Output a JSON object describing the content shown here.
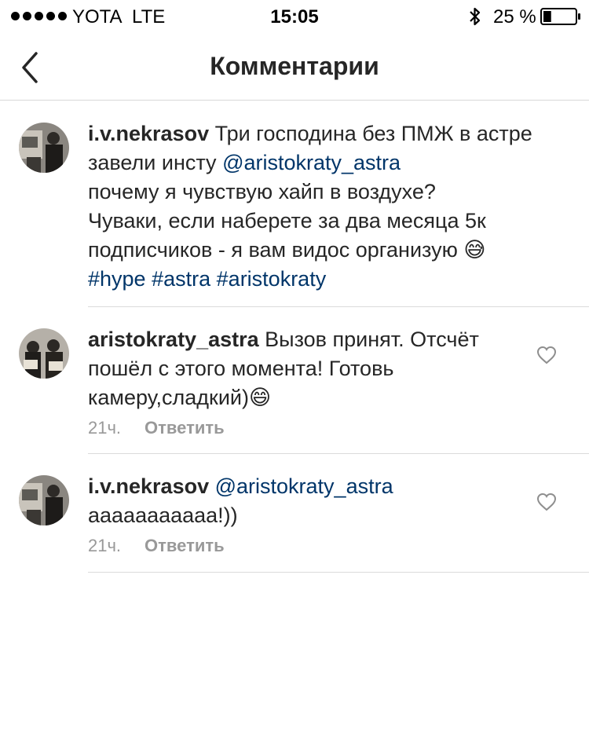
{
  "status_bar": {
    "carrier": "YOTA",
    "network": "LTE",
    "time": "15:05",
    "battery_percent": "25 %",
    "battery_level": 0.25,
    "icons": [
      "signal-dots-icon",
      "bluetooth-icon",
      "battery-icon"
    ]
  },
  "nav": {
    "title": "Комментарии",
    "back_icon": "chevron-left-icon"
  },
  "comments": [
    {
      "username": "i.v.nekrasov",
      "text_1": "Три господина без ПМЖ в астре",
      "text_2": "завели инсту",
      "mention": "@aristokraty_astra",
      "text_3": "почему я чувствую хайп в воздухе?",
      "text_4": "Чуваки, если наберете за два месяца 5к",
      "text_5": "подписчиков - я вам видос организую",
      "emoji": "😅",
      "hashtags": [
        "#hype",
        "#astra",
        "#aristokraty"
      ]
    },
    {
      "username": "aristokraty_astra",
      "text_1": "Вызов принят. Отсчёт",
      "text_2": "пошёл с этого момента! Готовь",
      "text_3": "камеру,сладкий)",
      "emoji": "😄",
      "time": "21ч.",
      "reply_label": "Ответить"
    },
    {
      "username": "i.v.nekrasov",
      "mention": "@aristokraty_astra",
      "text_1": "ааааааааааа!))",
      "time": "21ч.",
      "reply_label": "Ответить"
    }
  ],
  "colors": {
    "text": "#262626",
    "link": "#003569",
    "meta": "#999999",
    "divider": "#dbdbdb"
  }
}
